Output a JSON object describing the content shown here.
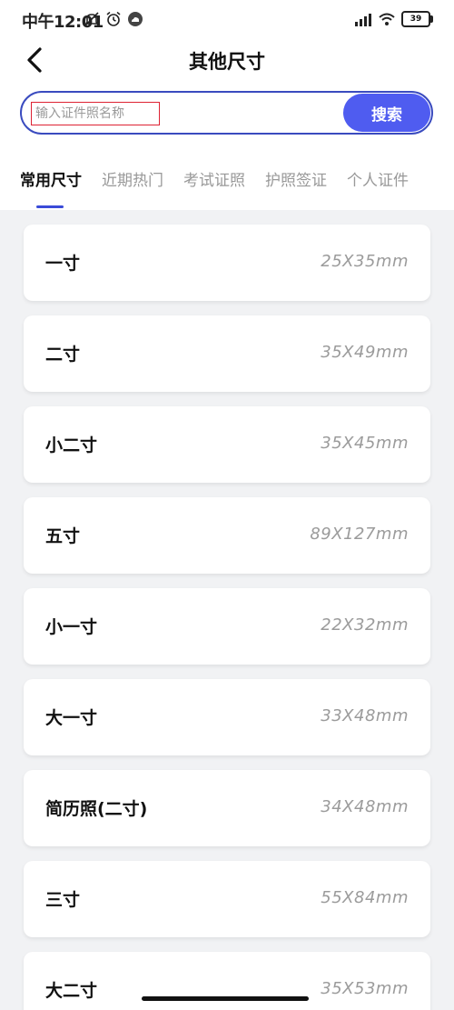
{
  "status_bar": {
    "time": "中午12:01",
    "battery": "39",
    "icons": [
      "mute-icon",
      "alarm-icon",
      "cloud-icon",
      "signal-icon",
      "wifi-icon",
      "battery-icon"
    ]
  },
  "header": {
    "title": "其他尺寸",
    "back_icon": "chevron-left-icon"
  },
  "search": {
    "placeholder": "输入证件照名称",
    "value": "",
    "button_label": "搜索",
    "accent_color": "#4f5cf0",
    "border_color": "#3a4bbf"
  },
  "tabs": [
    {
      "label": "常用尺寸",
      "active": true
    },
    {
      "label": "近期热门",
      "active": false
    },
    {
      "label": "考试证照",
      "active": false
    },
    {
      "label": "护照签证",
      "active": false
    },
    {
      "label": "个人证件",
      "active": false
    }
  ],
  "sizes": [
    {
      "name": "一寸",
      "dimensions": "25X35mm"
    },
    {
      "name": "二寸",
      "dimensions": "35X49mm"
    },
    {
      "name": "小二寸",
      "dimensions": "35X45mm"
    },
    {
      "name": "五寸",
      "dimensions": "89X127mm"
    },
    {
      "name": "小一寸",
      "dimensions": "22X32mm"
    },
    {
      "name": "大一寸",
      "dimensions": "33X48mm"
    },
    {
      "name": "简历照(二寸)",
      "dimensions": "34X48mm"
    },
    {
      "name": "三寸",
      "dimensions": "55X84mm"
    },
    {
      "name": "大二寸",
      "dimensions": "35X53mm"
    }
  ]
}
